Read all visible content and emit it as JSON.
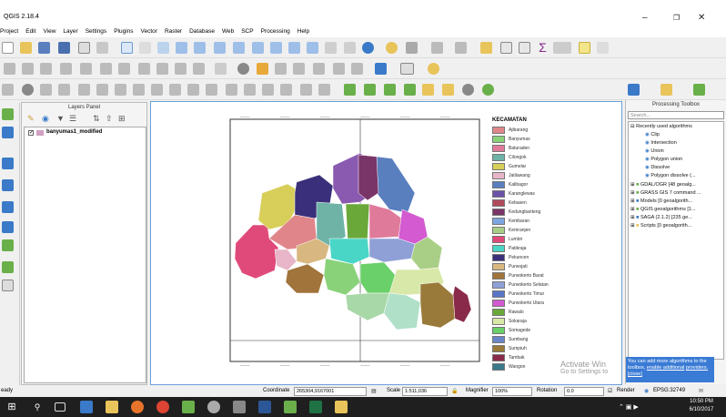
{
  "app": {
    "title": "QGIS 2.18.4"
  },
  "menu": [
    "Project",
    "Edit",
    "View",
    "Layer",
    "Settings",
    "Plugins",
    "Vector",
    "Raster",
    "Database",
    "Web",
    "SCP",
    "Processing",
    "Help"
  ],
  "layers_panel": {
    "title": "Layers Panel",
    "layer_name": "banyumas1_modified"
  },
  "legend": {
    "title": "KECAMATAN",
    "items": [
      {
        "label": "Ajibarang",
        "color": "#e0868a"
      },
      {
        "label": "Banyumas",
        "color": "#8ad27a"
      },
      {
        "label": "Baturaden",
        "color": "#e07a9a"
      },
      {
        "label": "Cilongok",
        "color": "#6fb3a7"
      },
      {
        "label": "Gumelar",
        "color": "#d8cf5a"
      },
      {
        "label": "Jatilawang",
        "color": "#e8b6c8"
      },
      {
        "label": "Kalibagor",
        "color": "#5a7fbf"
      },
      {
        "label": "Karanglewas",
        "color": "#6a52a8"
      },
      {
        "label": "Kebasen",
        "color": "#b04a5a"
      },
      {
        "label": "Kedungbanteng",
        "color": "#7a3568"
      },
      {
        "label": "Kembaran",
        "color": "#7ea6de"
      },
      {
        "label": "Kemranjen",
        "color": "#a9cf87"
      },
      {
        "label": "Lumbir",
        "color": "#e04a7a"
      },
      {
        "label": "Patikraja",
        "color": "#4ad6c6"
      },
      {
        "label": "Pekuncen",
        "color": "#3a2f7a"
      },
      {
        "label": "Purwojati",
        "color": "#d8b880"
      },
      {
        "label": "Purwokerto Barat",
        "color": "#a0743a"
      },
      {
        "label": "Purwokerto Selatan",
        "color": "#8fa0d6"
      },
      {
        "label": "Purwokerto Timur",
        "color": "#5a76c8"
      },
      {
        "label": "Purwokerto Utara",
        "color": "#d35ad0"
      },
      {
        "label": "Rawalo",
        "color": "#6aa83a"
      },
      {
        "label": "Sokaraja",
        "color": "#d8e8a8"
      },
      {
        "label": "Somagede",
        "color": "#6ad06a"
      },
      {
        "label": "Sumbang",
        "color": "#6a86c8"
      },
      {
        "label": "Sumpiuh",
        "color": "#9a7a3a"
      },
      {
        "label": "Tambak",
        "color": "#8a2a4a"
      },
      {
        "label": "Wangon",
        "color": "#3a7a8a"
      }
    ]
  },
  "toolbox": {
    "title": "Processing Toolbox",
    "search_placeholder": "Search...",
    "recent": "Recently used algorithms",
    "recent_items": [
      "Clip",
      "Intersection",
      "Union",
      "Polygon union",
      "Dissolve",
      "Polygon dissolve (..."
    ],
    "providers": [
      "GDAL/OGR [48 geoalg...",
      "GRASS GIS 7 command ...",
      "Models [0 geoalgorith...",
      "QGIS geoalgorithms [1...",
      "SAGA (2.1.2) [235 ge...",
      "Scripts [0 geoalgorith..."
    ],
    "tip_text": "You can add more algorithms to the toolbox,",
    "tip_link1": "enable additional",
    "tip_link2": "providers.",
    "tip_close": "[close]"
  },
  "status": {
    "left": "eady",
    "coordinate_label": "Coordinate",
    "coordinate": "265304,9167001",
    "scale_label": "Scale",
    "scale": "1:511,036",
    "magnifier_label": "Magnifier",
    "magnifier": "100%",
    "rotation_label": "Rotation",
    "rotation": "0.0",
    "render_label": "Render",
    "crs": "EPSG:32749"
  },
  "watermark": {
    "line1": "Activate Win",
    "line2": "Go to Settings to"
  },
  "taskbar": {
    "time": "10:50 PM",
    "date": "6/10/2017"
  }
}
